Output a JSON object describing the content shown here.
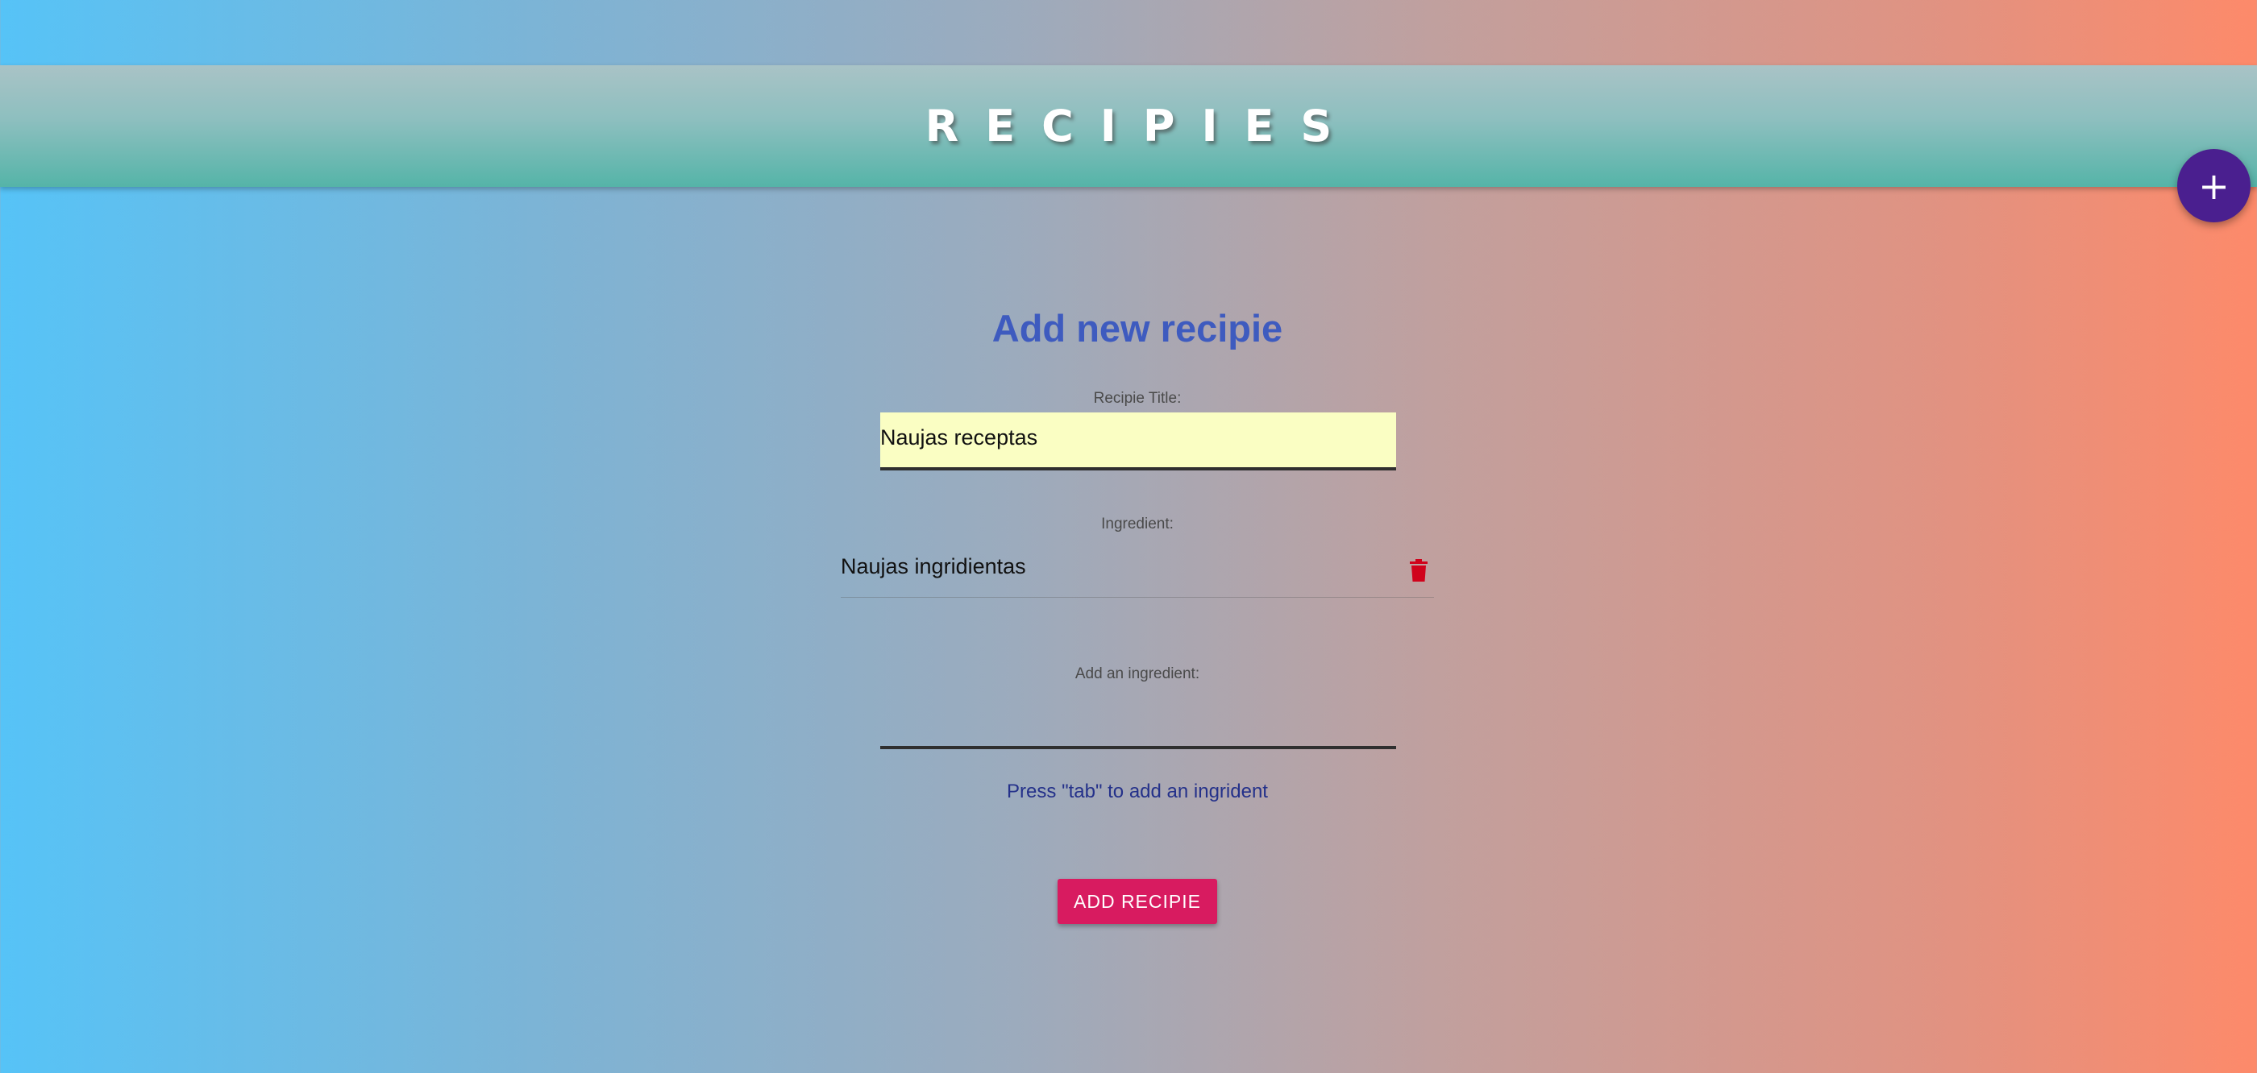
{
  "header": {
    "title": "RECIPIES"
  },
  "fab": {
    "icon": "plus-icon",
    "glyph": "+",
    "color": "#4a1f8f"
  },
  "form": {
    "heading": "Add new recipie",
    "title_label": "Recipie Title:",
    "title_value": "Naujas receptas",
    "ingredient_label": "Ingredient:",
    "ingredients": [
      {
        "name": "Naujas ingridientas",
        "delete_icon": "trash-icon"
      }
    ],
    "add_ingredient_label": "Add an ingredient:",
    "add_ingredient_value": "",
    "hint": "Press \"tab\" to add an ingrident",
    "submit_label": "ADD RECIPIE"
  },
  "colors": {
    "heading": "#3e5bbf",
    "hint": "#24318a",
    "submit": "#d81b60",
    "title_input_bg": "#fafec3",
    "trash": "#d0021b"
  }
}
